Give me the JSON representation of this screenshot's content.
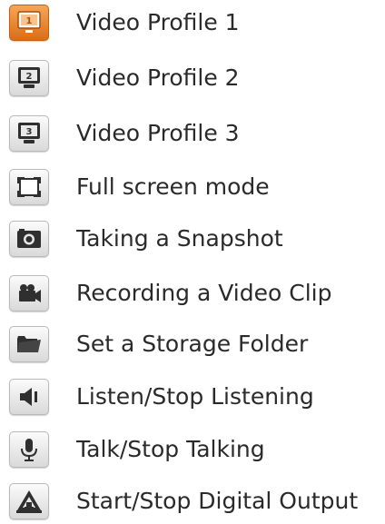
{
  "legend": {
    "items": [
      {
        "label": "Video Profile 1",
        "icon": "video-profile-1-icon",
        "active": true
      },
      {
        "label": "Video Profile 2",
        "icon": "video-profile-2-icon",
        "active": false
      },
      {
        "label": "Video Profile 3",
        "icon": "video-profile-3-icon",
        "active": false
      },
      {
        "label": "Full screen mode",
        "icon": "fullscreen-icon",
        "active": false
      },
      {
        "label": "Taking a Snapshot",
        "icon": "camera-icon",
        "active": false
      },
      {
        "label": "Recording a Video Clip",
        "icon": "video-camera-icon",
        "active": false
      },
      {
        "label": "Set a Storage Folder",
        "icon": "folder-icon",
        "active": false
      },
      {
        "label": "Listen/Stop Listening",
        "icon": "speaker-icon",
        "active": false
      },
      {
        "label": "Talk/Stop Talking",
        "icon": "microphone-icon",
        "active": false
      },
      {
        "label": "Start/Stop Digital Output",
        "icon": "alarm-icon",
        "active": false
      }
    ],
    "profile_digits": [
      "1",
      "2",
      "3"
    ],
    "colors": {
      "active_orange": "#e07a1f",
      "icon_dark": "#333333",
      "text": "#2a2a2a"
    }
  }
}
